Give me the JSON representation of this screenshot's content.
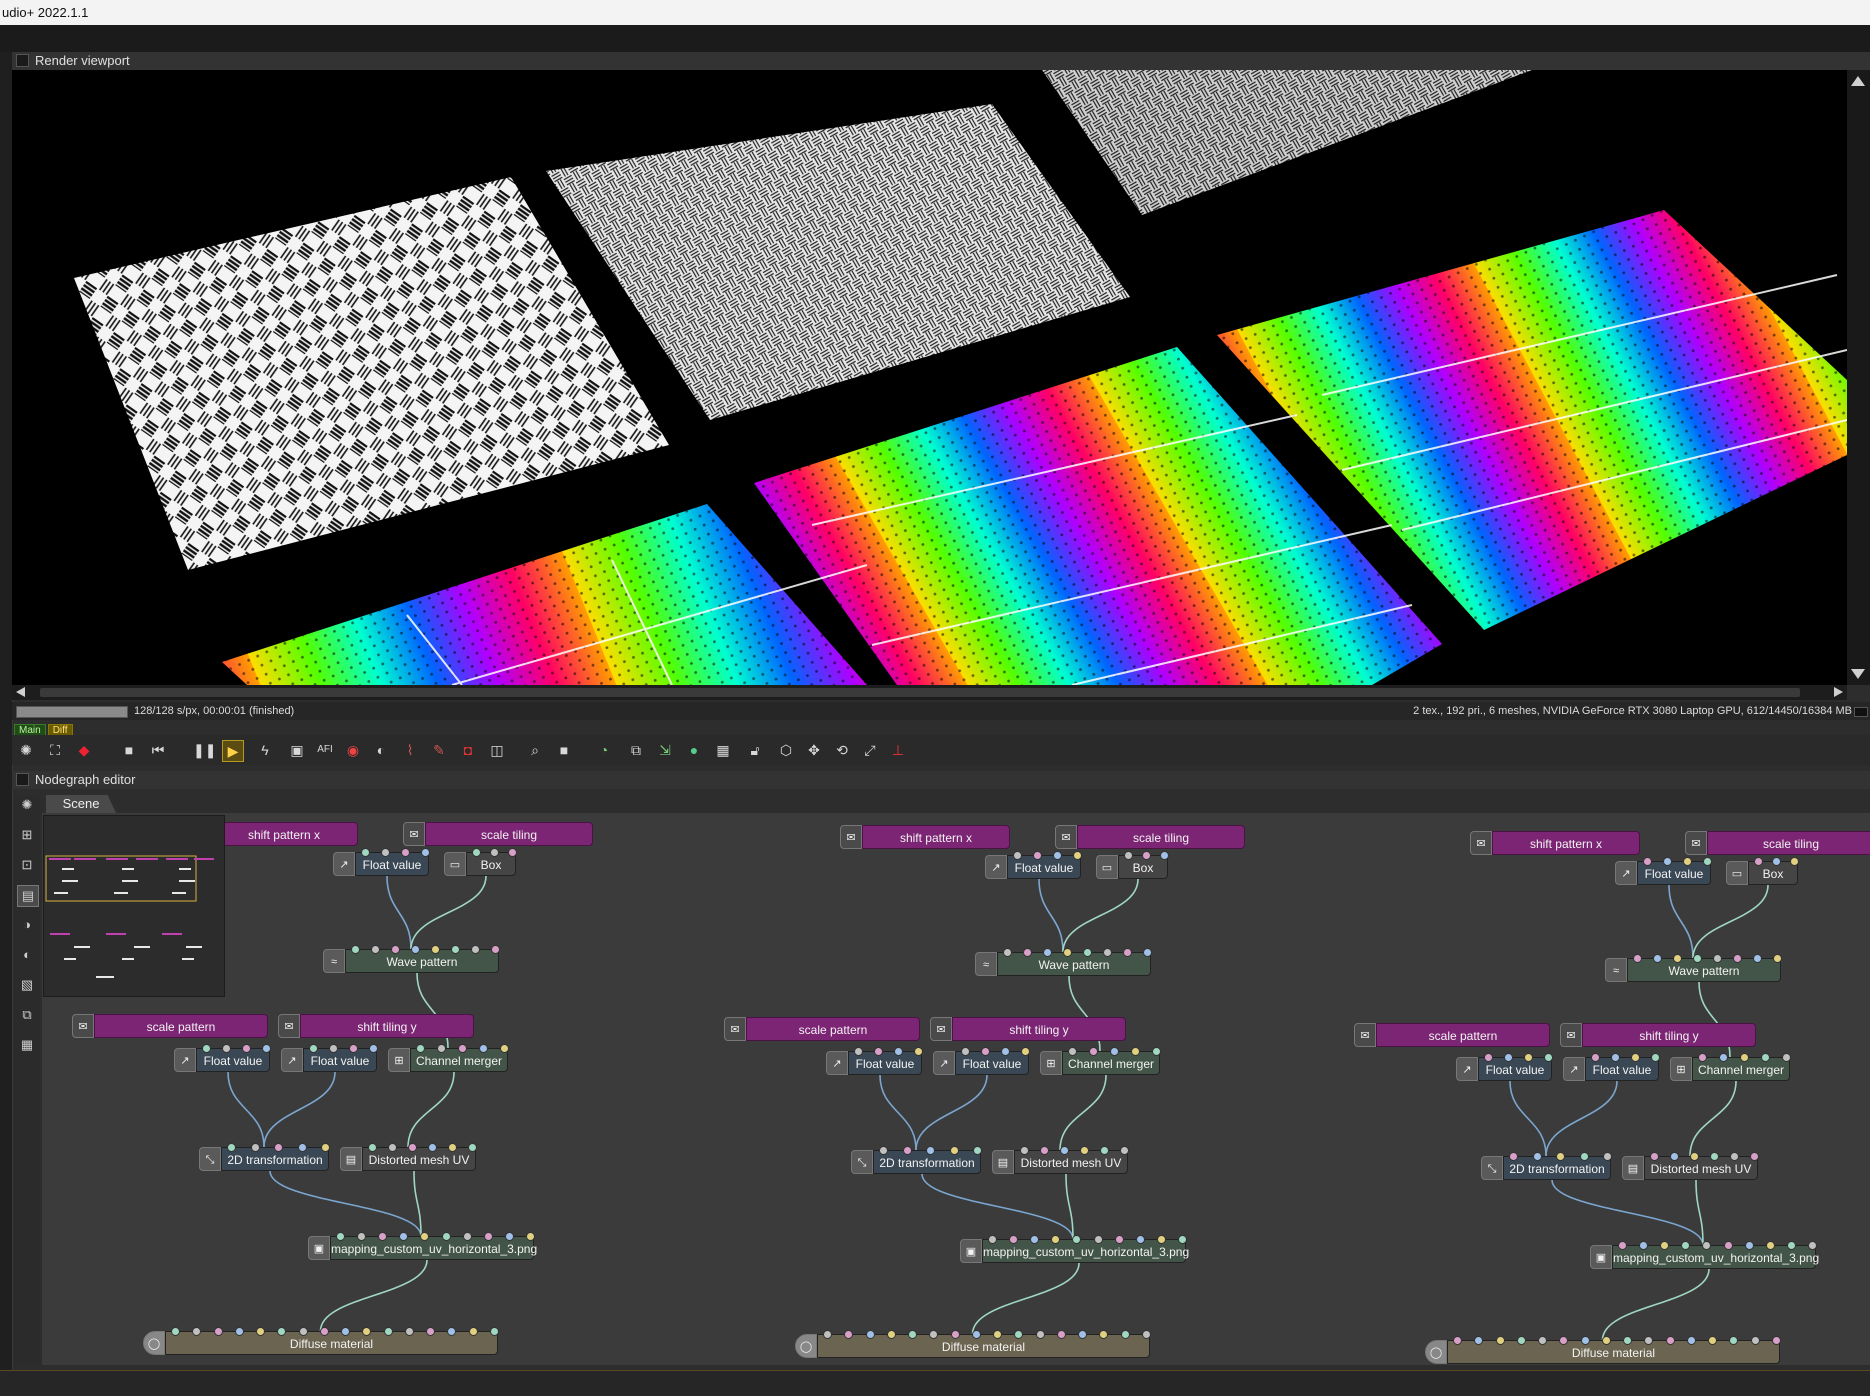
{
  "window": {
    "title": "udio+ 2022.1.1"
  },
  "render_panel": {
    "title": "Render viewport"
  },
  "status": {
    "left": "128/128 s/px, 00:00:01 (finished)",
    "right": "2 tex., 192 pri., 6 meshes, NVIDIA GeForce RTX 3080 Laptop GPU, 612/14450/16384 MB",
    "progress": 1.0,
    "tab_main": "Main",
    "tab_diff": "Diff"
  },
  "nodegraph_panel": {
    "title": "Nodegraph editor",
    "tab": "Scene"
  },
  "graphs": [
    {
      "nodes": {
        "c_shift_x": "shift pattern x",
        "c_scale_tiling": "scale tiling",
        "float_a": "Float value",
        "box": "Box",
        "wave": "Wave pattern",
        "c_scale_pattern": "scale pattern",
        "c_shift_y": "shift tiling y",
        "float_b": "Float value",
        "float_c": "Float value",
        "merger": "Channel merger",
        "transform": "2D transformation",
        "distort": "Distorted mesh UV",
        "image": "mapping_custom_uv_horizontal_3.png",
        "material": "Diffuse material"
      }
    },
    {
      "nodes": {
        "c_shift_x": "shift pattern x",
        "c_scale_tiling": "scale tiling",
        "float_a": "Float value",
        "box": "Box",
        "wave": "Wave pattern",
        "c_scale_pattern": "scale pattern",
        "c_shift_y": "shift tiling y",
        "float_b": "Float value",
        "float_c": "Float value",
        "merger": "Channel merger",
        "transform": "2D transformation",
        "distort": "Distorted mesh UV",
        "image": "mapping_custom_uv_horizontal_3.png",
        "material": "Diffuse material"
      }
    },
    {
      "nodes": {
        "c_shift_x": "shift pattern x",
        "c_scale_tiling": "scale tiling",
        "float_a": "Float value",
        "box": "Box",
        "wave": "Wave pattern",
        "c_scale_pattern": "scale pattern",
        "c_shift_y": "shift tiling y",
        "float_b": "Float value",
        "float_c": "Float value",
        "merger": "Channel merger",
        "transform": "2D transformation",
        "distort": "Distorted mesh UV",
        "image": "mapping_custom_uv_horizontal_3.png",
        "material": "Diffuse material"
      }
    }
  ],
  "toolbar": {
    "icons": [
      "render-settings-icon",
      "render-region-icon",
      "color-cube-icon",
      "stop-icon",
      "restart-icon",
      "pause-icon",
      "play-icon",
      "lightning-icon",
      "display-icon",
      "aov-icon",
      "color-wheel-icon",
      "sphere-icon",
      "curve-icon",
      "brush-icon",
      "cube-red-icon",
      "cube-outline-icon",
      "zoom-icon",
      "region-icon",
      "gauge-icon",
      "copy-icon",
      "paste-icon",
      "sphere-green-icon",
      "checker-icon",
      "lock-icon",
      "wireframe-cube-icon",
      "move-icon",
      "rotate-icon",
      "fullscreen-icon",
      "axis-icon"
    ]
  },
  "colors": {
    "comment_node": "#7d2575",
    "float_node": "#3a4855",
    "proc_node": "#435548",
    "material_node": "#6a6450",
    "graph_bg": "#3b3b3b"
  }
}
